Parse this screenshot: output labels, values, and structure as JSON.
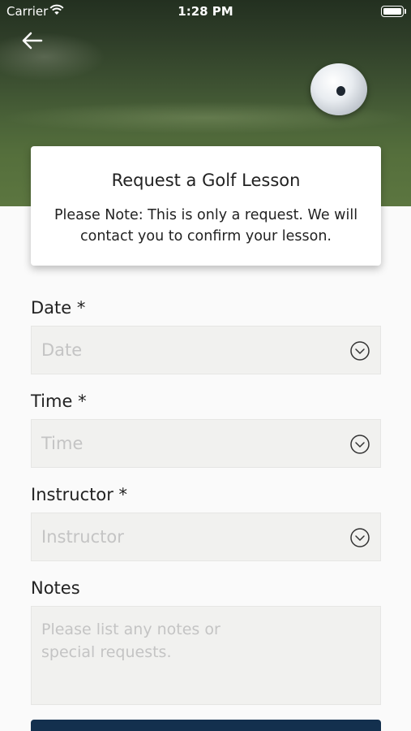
{
  "status_bar": {
    "carrier": "Carrier",
    "time": "1:28 PM"
  },
  "header": {
    "back_icon": "arrow-left-icon"
  },
  "card": {
    "title": "Request a Golf Lesson",
    "note": "Please Note: This is only a request. We will contact you to confirm your lesson."
  },
  "form": {
    "date": {
      "label": "Date *",
      "placeholder": "Date",
      "icon": "chevron-down-circle-icon"
    },
    "time": {
      "label": "Time *",
      "placeholder": "Time",
      "icon": "chevron-down-circle-icon"
    },
    "instructor": {
      "label": "Instructor *",
      "placeholder": "Instructor",
      "icon": "chevron-down-circle-icon"
    },
    "notes": {
      "label": "Notes",
      "placeholder": "Please list any notes or\nspecial requests."
    }
  },
  "colors": {
    "primary_button": "#13304e",
    "field_background": "#f1f1ef",
    "placeholder_text": "#c4c4c4"
  }
}
